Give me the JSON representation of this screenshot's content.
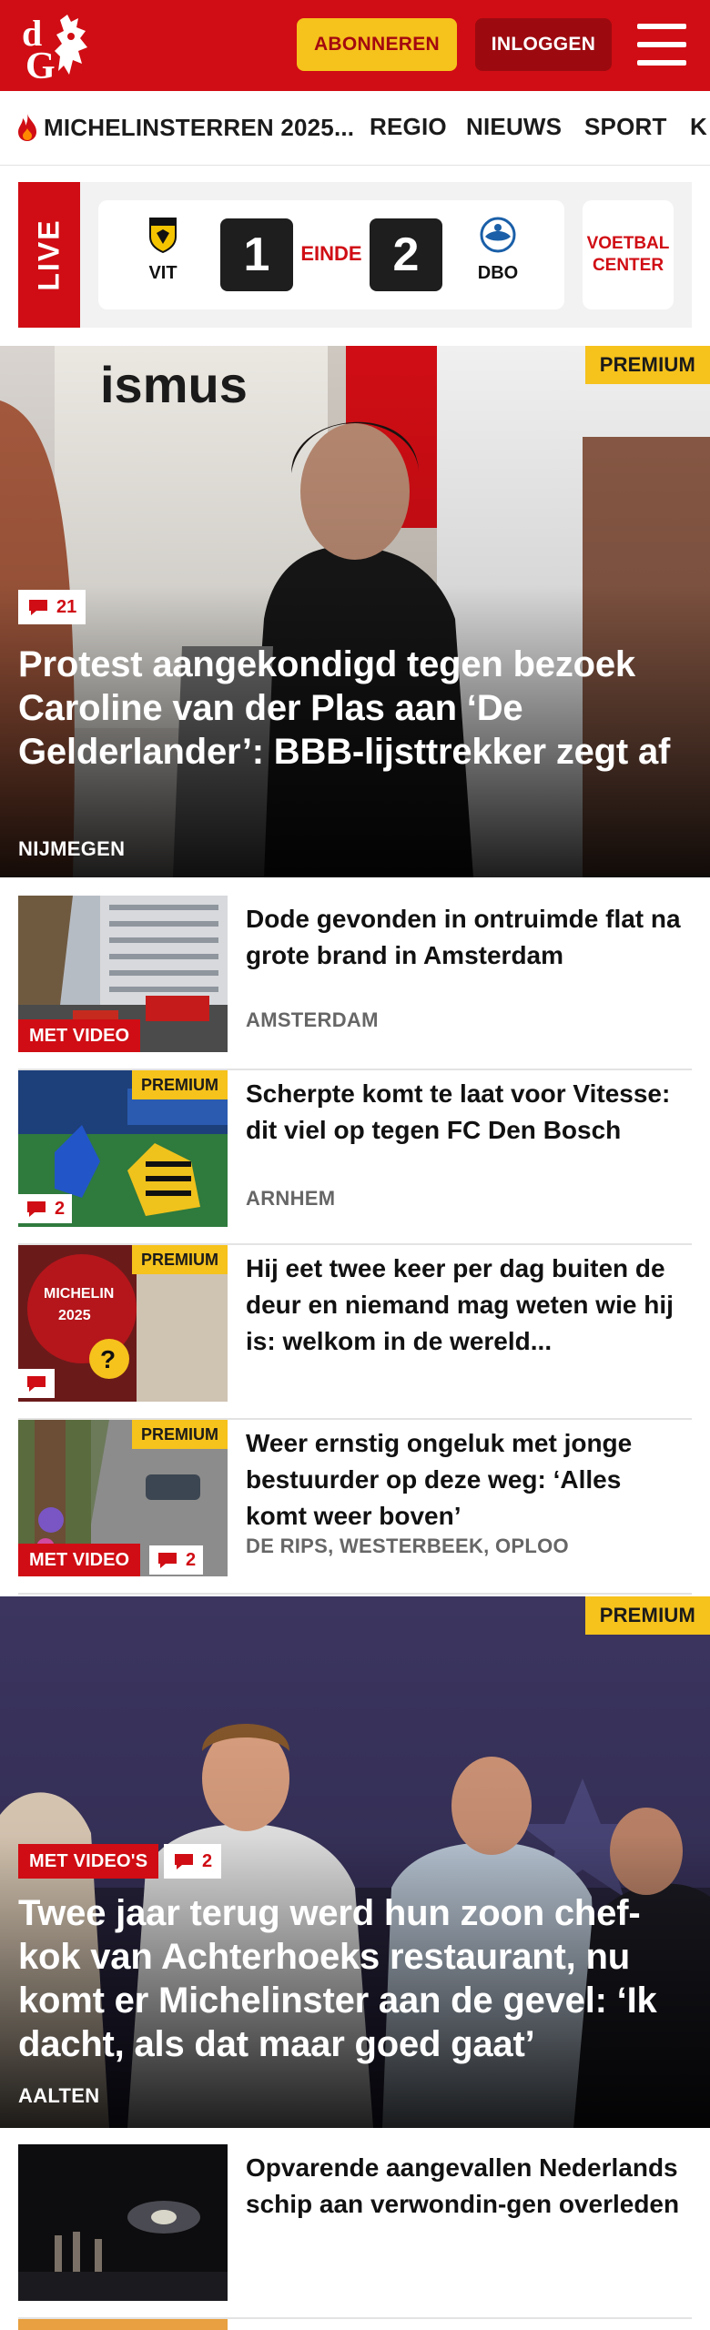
{
  "header": {
    "logo_text": "dG",
    "subscribe_label": "ABONNEREN",
    "login_label": "INLOGGEN",
    "brand_color": "#d00d14",
    "accent_color": "#f6c21c"
  },
  "nav": {
    "items": [
      {
        "label": "MICHELINSTERREN 2025...",
        "icon": "flame-icon"
      },
      {
        "label": "REGIO"
      },
      {
        "label": "NIEUWS"
      },
      {
        "label": "SPORT"
      },
      {
        "label": "K"
      }
    ]
  },
  "live": {
    "tag": "LIVE",
    "home_team": "VIT",
    "away_team": "DBO",
    "home_score": "1",
    "away_score": "2",
    "status": "EINDE",
    "voetbal_center": "VOETBAL CENTER"
  },
  "hero1": {
    "badge": "PREMIUM",
    "comments": "21",
    "title": "Protest aangekondigd tegen bezoek Caroline van der Plas aan ‘De Gelderlander’: BBB-lijsttrekker zegt af",
    "location": "NIJMEGEN"
  },
  "articles": [
    {
      "title": "Dode gevonden in ontruimde flat na grote brand in Amsterdam",
      "location": "AMSTERDAM",
      "video": "MET VIDEO",
      "premium": "",
      "comments": ""
    },
    {
      "title": "Scherpte komt te laat voor Vitesse: dit viel op tegen FC Den Bosch",
      "location": "ARNHEM",
      "video": "",
      "premium": "PREMIUM",
      "comments": "2"
    },
    {
      "title": "Hij eet twee keer per dag buiten de deur en niemand mag weten wie hij is: welkom in de wereld...",
      "location": "",
      "video": "",
      "premium": "PREMIUM",
      "comments": ""
    },
    {
      "title": "Weer ernstig ongeluk met jonge bestuurder op deze weg: ‘Alles komt weer boven’",
      "location": "DE RIPS, WESTERBEEK, OPLOO",
      "video": "MET VIDEO",
      "premium": "PREMIUM",
      "comments": "2"
    }
  ],
  "hero2": {
    "badge": "PREMIUM",
    "video": "MET VIDEO'S",
    "comments": "2",
    "title": "Twee jaar terug werd hun zoon chef-kok van Achterhoeks restaurant, nu komt er Michelinster aan de gevel: ‘Ik dacht, als dat maar goed gaat’",
    "location": "AALTEN"
  },
  "articles2": [
    {
      "title": "Opvarende aangevallen Nederlands schip aan verwondin-gen overleden"
    }
  ]
}
